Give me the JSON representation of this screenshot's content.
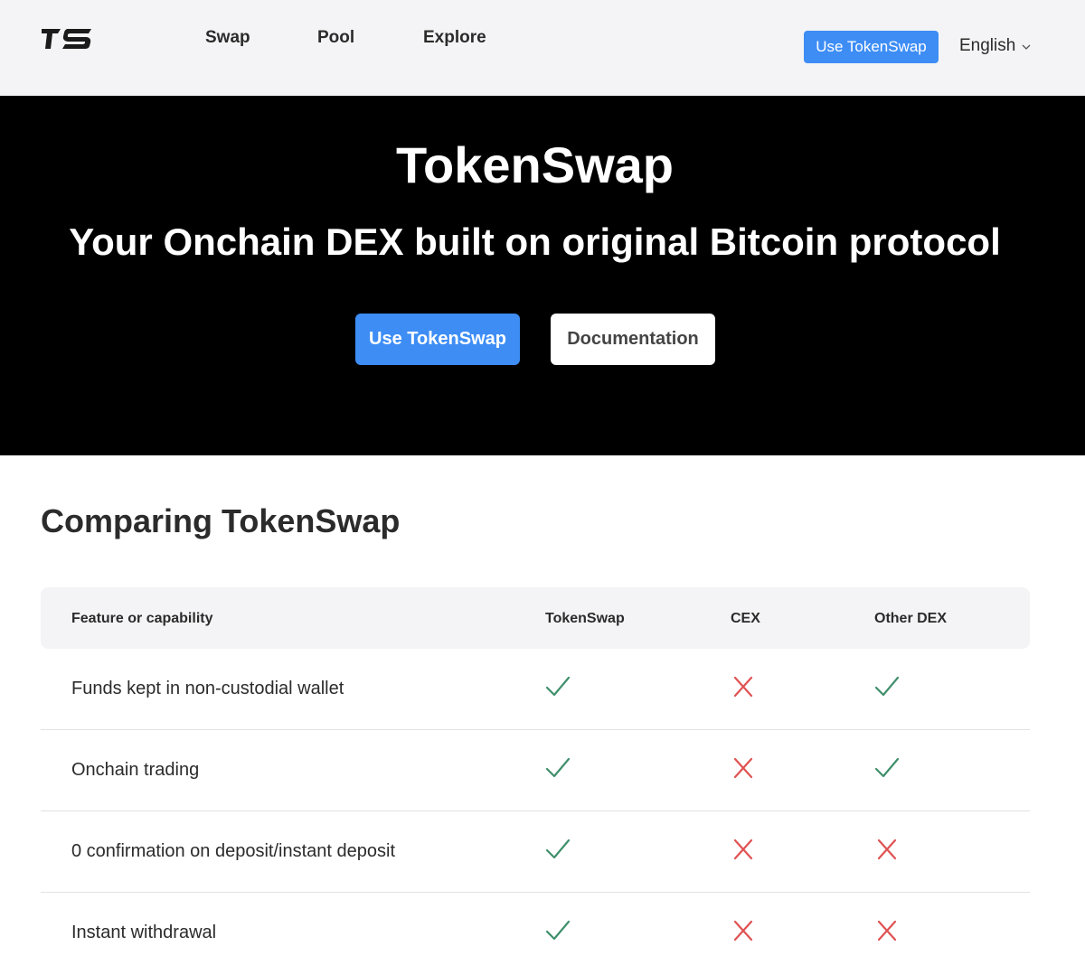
{
  "header": {
    "logo_text": "TS",
    "nav": [
      {
        "label": "Swap"
      },
      {
        "label": "Pool"
      },
      {
        "label": "Explore"
      }
    ],
    "cta_label": "Use TokenSwap",
    "language": "English"
  },
  "hero": {
    "title": "TokenSwap",
    "subtitle": "Your Onchain DEX built on original Bitcoin protocol",
    "primary_button": "Use TokenSwap",
    "secondary_button": "Documentation"
  },
  "comparison": {
    "title": "Comparing TokenSwap",
    "columns": [
      "Feature or capability",
      "TokenSwap",
      "CEX",
      "Other DEX"
    ],
    "rows": [
      {
        "feature": "Funds kept in non-custodial wallet",
        "values": [
          true,
          false,
          true
        ]
      },
      {
        "feature": "Onchain trading",
        "values": [
          true,
          false,
          true
        ]
      },
      {
        "feature": "0 confirmation on deposit/instant deposit",
        "values": [
          true,
          false,
          false
        ]
      },
      {
        "feature": "Instant withdrawal",
        "values": [
          true,
          false,
          false
        ]
      }
    ]
  },
  "colors": {
    "accent": "#3d8df5",
    "check": "#3f8f6b",
    "cross": "#e05252",
    "header_bg": "#f4f4f6",
    "hero_bg": "#000000"
  }
}
